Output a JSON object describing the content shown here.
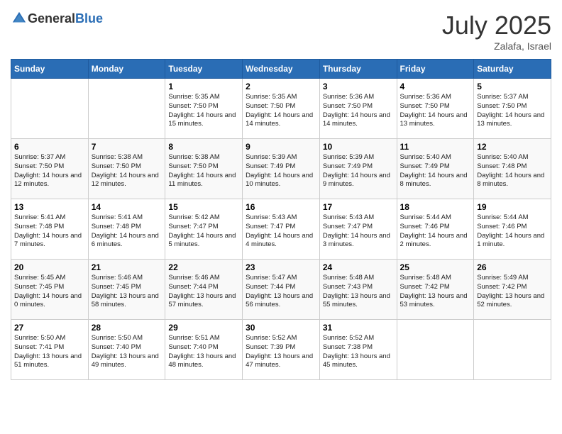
{
  "header": {
    "logo_general": "General",
    "logo_blue": "Blue",
    "month": "July 2025",
    "location": "Zalafa, Israel"
  },
  "weekdays": [
    "Sunday",
    "Monday",
    "Tuesday",
    "Wednesday",
    "Thursday",
    "Friday",
    "Saturday"
  ],
  "weeks": [
    [
      {
        "day": "",
        "content": ""
      },
      {
        "day": "",
        "content": ""
      },
      {
        "day": "1",
        "content": "Sunrise: 5:35 AM\nSunset: 7:50 PM\nDaylight: 14 hours and 15 minutes."
      },
      {
        "day": "2",
        "content": "Sunrise: 5:35 AM\nSunset: 7:50 PM\nDaylight: 14 hours and 14 minutes."
      },
      {
        "day": "3",
        "content": "Sunrise: 5:36 AM\nSunset: 7:50 PM\nDaylight: 14 hours and 14 minutes."
      },
      {
        "day": "4",
        "content": "Sunrise: 5:36 AM\nSunset: 7:50 PM\nDaylight: 14 hours and 13 minutes."
      },
      {
        "day": "5",
        "content": "Sunrise: 5:37 AM\nSunset: 7:50 PM\nDaylight: 14 hours and 13 minutes."
      }
    ],
    [
      {
        "day": "6",
        "content": "Sunrise: 5:37 AM\nSunset: 7:50 PM\nDaylight: 14 hours and 12 minutes."
      },
      {
        "day": "7",
        "content": "Sunrise: 5:38 AM\nSunset: 7:50 PM\nDaylight: 14 hours and 12 minutes."
      },
      {
        "day": "8",
        "content": "Sunrise: 5:38 AM\nSunset: 7:50 PM\nDaylight: 14 hours and 11 minutes."
      },
      {
        "day": "9",
        "content": "Sunrise: 5:39 AM\nSunset: 7:49 PM\nDaylight: 14 hours and 10 minutes."
      },
      {
        "day": "10",
        "content": "Sunrise: 5:39 AM\nSunset: 7:49 PM\nDaylight: 14 hours and 9 minutes."
      },
      {
        "day": "11",
        "content": "Sunrise: 5:40 AM\nSunset: 7:49 PM\nDaylight: 14 hours and 8 minutes."
      },
      {
        "day": "12",
        "content": "Sunrise: 5:40 AM\nSunset: 7:48 PM\nDaylight: 14 hours and 8 minutes."
      }
    ],
    [
      {
        "day": "13",
        "content": "Sunrise: 5:41 AM\nSunset: 7:48 PM\nDaylight: 14 hours and 7 minutes."
      },
      {
        "day": "14",
        "content": "Sunrise: 5:41 AM\nSunset: 7:48 PM\nDaylight: 14 hours and 6 minutes."
      },
      {
        "day": "15",
        "content": "Sunrise: 5:42 AM\nSunset: 7:47 PM\nDaylight: 14 hours and 5 minutes."
      },
      {
        "day": "16",
        "content": "Sunrise: 5:43 AM\nSunset: 7:47 PM\nDaylight: 14 hours and 4 minutes."
      },
      {
        "day": "17",
        "content": "Sunrise: 5:43 AM\nSunset: 7:47 PM\nDaylight: 14 hours and 3 minutes."
      },
      {
        "day": "18",
        "content": "Sunrise: 5:44 AM\nSunset: 7:46 PM\nDaylight: 14 hours and 2 minutes."
      },
      {
        "day": "19",
        "content": "Sunrise: 5:44 AM\nSunset: 7:46 PM\nDaylight: 14 hours and 1 minute."
      }
    ],
    [
      {
        "day": "20",
        "content": "Sunrise: 5:45 AM\nSunset: 7:45 PM\nDaylight: 14 hours and 0 minutes."
      },
      {
        "day": "21",
        "content": "Sunrise: 5:46 AM\nSunset: 7:45 PM\nDaylight: 13 hours and 58 minutes."
      },
      {
        "day": "22",
        "content": "Sunrise: 5:46 AM\nSunset: 7:44 PM\nDaylight: 13 hours and 57 minutes."
      },
      {
        "day": "23",
        "content": "Sunrise: 5:47 AM\nSunset: 7:44 PM\nDaylight: 13 hours and 56 minutes."
      },
      {
        "day": "24",
        "content": "Sunrise: 5:48 AM\nSunset: 7:43 PM\nDaylight: 13 hours and 55 minutes."
      },
      {
        "day": "25",
        "content": "Sunrise: 5:48 AM\nSunset: 7:42 PM\nDaylight: 13 hours and 53 minutes."
      },
      {
        "day": "26",
        "content": "Sunrise: 5:49 AM\nSunset: 7:42 PM\nDaylight: 13 hours and 52 minutes."
      }
    ],
    [
      {
        "day": "27",
        "content": "Sunrise: 5:50 AM\nSunset: 7:41 PM\nDaylight: 13 hours and 51 minutes."
      },
      {
        "day": "28",
        "content": "Sunrise: 5:50 AM\nSunset: 7:40 PM\nDaylight: 13 hours and 49 minutes."
      },
      {
        "day": "29",
        "content": "Sunrise: 5:51 AM\nSunset: 7:40 PM\nDaylight: 13 hours and 48 minutes."
      },
      {
        "day": "30",
        "content": "Sunrise: 5:52 AM\nSunset: 7:39 PM\nDaylight: 13 hours and 47 minutes."
      },
      {
        "day": "31",
        "content": "Sunrise: 5:52 AM\nSunset: 7:38 PM\nDaylight: 13 hours and 45 minutes."
      },
      {
        "day": "",
        "content": ""
      },
      {
        "day": "",
        "content": ""
      }
    ]
  ]
}
